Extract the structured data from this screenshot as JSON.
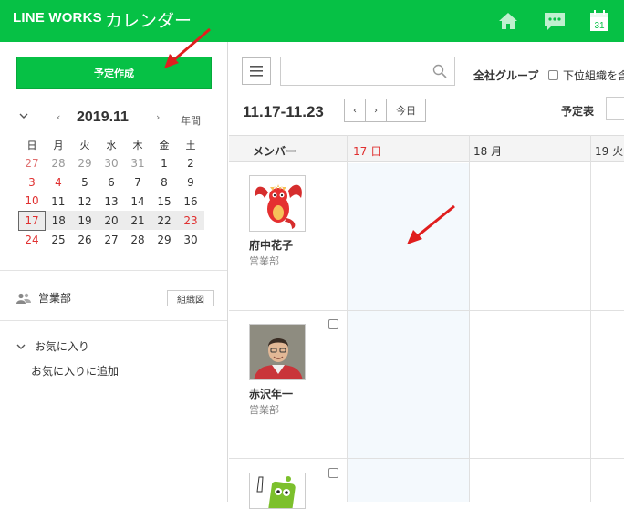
{
  "header": {
    "brand": "LINE WORKS",
    "app": "カレンダー",
    "calendar_icon_day": "31",
    "accent": "#06c145"
  },
  "sidebar": {
    "new_button": "予定作成",
    "mini_cal": {
      "year_month": "2019.11",
      "mode": "年間",
      "prev": "‹",
      "next": "›",
      "weekdays": [
        "日",
        "月",
        "火",
        "水",
        "木",
        "金",
        "土"
      ],
      "weeks": [
        [
          "27",
          "28",
          "29",
          "30",
          "31",
          "1",
          "2"
        ],
        [
          "3",
          "4",
          "5",
          "6",
          "7",
          "8",
          "9"
        ],
        [
          "10",
          "11",
          "12",
          "13",
          "14",
          "15",
          "16"
        ],
        [
          "17",
          "18",
          "19",
          "20",
          "21",
          "22",
          "23"
        ],
        [
          "24",
          "25",
          "26",
          "27",
          "28",
          "29",
          "30"
        ]
      ]
    },
    "group": "営業部",
    "org_button": "組織図",
    "favorites": "お気に入り",
    "add_favorite": "お気に入りに追加"
  },
  "toolbar": {
    "search_placeholder": "",
    "group_label": "全社グループ",
    "sub_org_label": "下位組織を含",
    "range": "11.17-11.23",
    "prev": "‹",
    "next": "›",
    "today": "今日",
    "view_label": "予定表"
  },
  "grid": {
    "member_header": "メンバー",
    "days": [
      {
        "label": "17 日",
        "color": "#e03030"
      },
      {
        "label": "18 月",
        "color": "#333333"
      },
      {
        "label": "19 火",
        "color": "#333333"
      }
    ],
    "members": [
      {
        "name": "府中花子",
        "dept": "営業部",
        "avatar": "dragon-avatar"
      },
      {
        "name": "赤沢年一",
        "dept": "営業部",
        "avatar": "man-photo-avatar"
      },
      {
        "name": "",
        "dept": "",
        "avatar": "mascot-avatar"
      }
    ]
  }
}
